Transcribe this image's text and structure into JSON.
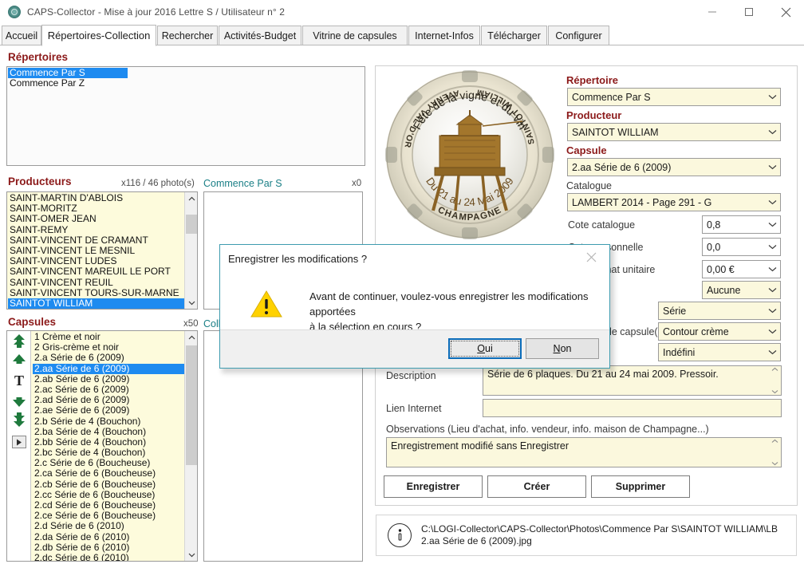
{
  "window": {
    "title": "CAPS-Collector - Mise à jour 2016 Lettre S / Utilisateur n° 2",
    "minimize": "minimize-icon",
    "maximize": "maximize-icon",
    "close": "close-icon"
  },
  "tabs": [
    {
      "label": "Accueil",
      "active": false
    },
    {
      "label": "Répertoires-Collection",
      "active": true
    },
    {
      "label": "Rechercher",
      "active": false
    },
    {
      "label": "Activités-Budget",
      "active": false
    },
    {
      "label": "Vitrine de capsules",
      "active": false
    },
    {
      "label": "Internet-Infos",
      "active": false
    },
    {
      "label": "Télécharger",
      "active": false
    },
    {
      "label": "Configurer",
      "active": false
    }
  ],
  "repertoires": {
    "heading": "Répertoires",
    "items": [
      "Commence Par S",
      "Commence Par Z"
    ],
    "selected_index": 0
  },
  "producteurs": {
    "heading": "Producteurs",
    "count": "x116 / 46 photo(s)",
    "current_repertoire": "Commence Par S",
    "right_count": "x0",
    "items": [
      "SAINT-MARTIN D'ABLOIS",
      "SAINT-MORITZ",
      "SAINT-OMER JEAN",
      "SAINT-REMY",
      "SAINT-VINCENT DE CRAMANT",
      "SAINT-VINCENT LE MESNIL",
      "SAINT-VINCENT LUDES",
      "SAINT-VINCENT MAREUIL LE PORT",
      "SAINT-VINCENT REUIL",
      "SAINT-VINCENT TOURS-SUR-MARNE",
      "SAINTOT WILLIAM"
    ],
    "selected_index": 10
  },
  "capsules": {
    "heading": "Capsules",
    "count": "x50",
    "right_label": "Colle",
    "items": [
      "1 Crème et noir",
      "2 Gris-crème et noir",
      "2.a Série de 6 (2009)",
      "2.aa Série de 6 (2009)",
      "2.ab Série de 6 (2009)",
      "2.ac Série de 6 (2009)",
      "2.ad Série de 6 (2009)",
      "2.ae Série de 6 (2009)",
      "2.b Série de 4 (Bouchon)",
      "2.ba Série de 4 (Bouchon)",
      "2.bb Série de 4 (Bouchon)",
      "2.bc Série de 4 (Bouchon)",
      "2.c Série de 6 (Boucheuse)",
      "2.ca Série de 6 (Boucheuse)",
      "2.cb Série de 6 (Boucheuse)",
      "2.cc Série de 6 (Boucheuse)",
      "2.cd Série de 6 (Boucheuse)",
      "2.ce Série de 6 (Boucheuse)",
      "2.d Série de 6 (2010)",
      "2.da Série de 6 (2010)",
      "2.db Série de 6 (2010)",
      "2.dc Série de 6 (2010)"
    ],
    "selected_index": 3,
    "nav_buttons": [
      "first",
      "previous",
      "top-letter",
      "next",
      "last",
      "play"
    ]
  },
  "form": {
    "repertoire_label": "Répertoire",
    "repertoire_value": "Commence Par S",
    "producteur_label": "Producteur",
    "producteur_value": "SAINTOT WILLIAM",
    "capsule_label": "Capsule",
    "capsule_value": "2.aa Série de 6 (2009)",
    "catalogue_label": "Catalogue",
    "catalogue_value": "LAMBERT 2014 - Page 291 - G",
    "cote_catalogue_label": "Cote catalogue",
    "cote_catalogue_value": "0,8",
    "cote_personnelle_label": "Cote personnelle",
    "cote_personnelle_value": "0,0",
    "prix_unitaire_label": "Prix d'achat unitaire",
    "prix_unitaire_value": "0,00 €",
    "rarete_value": "Aucune",
    "type_value": "Série",
    "nombre_label": "Nombre de capsule(s)",
    "contour_value": "Contour crème",
    "etat_value": "Indéfini",
    "description_label": "Description",
    "description_value": "Série de 6 plaques. Du 21 au 24 mai 2009. Pressoir.",
    "lien_label": "Lien Internet",
    "lien_value": "",
    "observations_label": "Observations (Lieu d'achat, info. vendeur, info. maison de Champagne...)",
    "observations_value": "Enregistrement modifié sans Enregistrer",
    "btn_enregistrer": "Enregistrer",
    "btn_creer": "Créer",
    "btn_supprimer": "Supprimer"
  },
  "photo": {
    "alt": "capsule-photo",
    "top_text": "CHAMPAGNE",
    "left_text": "SAINTOT WILLIAM",
    "right_text": "AVENAY VAL D'OR",
    "center_top": "Fête de la vigne et du vin",
    "center_bottom": "Du 21 au 24 Mai 2009"
  },
  "path": {
    "icon": "info-icon",
    "line1": "C:\\LOGI-Collector\\CAPS-Collector\\Photos\\Commence Par S\\SAINTOT WILLIAM\\LB",
    "line2": "2.aa Série de 6 (2009).jpg"
  },
  "dialog": {
    "title": "Enregistrer les modifications ?",
    "close": "close-icon",
    "warning_icon": "warning-triangle-icon",
    "message_line1": "Avant de continuer, voulez-vous enregistrer les modifications apportées",
    "message_line2": "à la sélection en cours ?",
    "btn_yes": "Oui",
    "btn_yes_accel": "O",
    "btn_no": "Non",
    "btn_no_accel": "N"
  },
  "colors": {
    "heading": "#8c1a1a",
    "selection": "#1e8bf0",
    "field_bg": "#fbf8dd",
    "teal": "#1a7f86",
    "dialog_border": "#3f9cb0"
  }
}
